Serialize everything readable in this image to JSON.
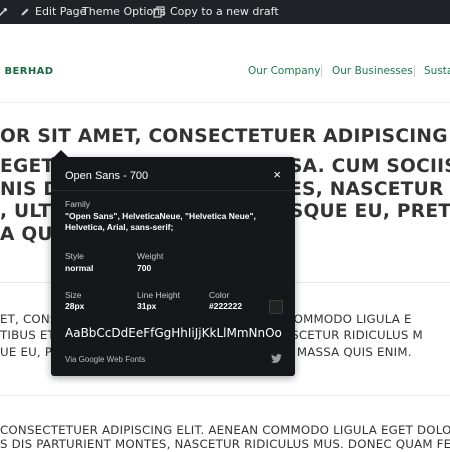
{
  "adminbar": {
    "items": [
      {
        "label": "",
        "icon": "customize-icon"
      },
      {
        "label": "Edit Page",
        "icon": "pencil-icon"
      },
      {
        "label": "Theme Options",
        "icon": ""
      },
      {
        "label": "Copy to a new draft",
        "icon": "copy-icon"
      }
    ]
  },
  "header": {
    "logo": "G BERHAD",
    "nav": [
      "Our Company",
      "Our Businesses",
      "Susta"
    ]
  },
  "content": {
    "large_lines": [
      "OR SIT AMET, CONSECTETUER ADIPISCING ELIT.",
      "EGET DOLOR. AENEAN MASSA. CUM SOCIIS NA",
      "NIS DIS PARTURIENT MONTES, NASCETUR RID",
      ", ULTRICIES NEC, PELLENTESQUE EU, PRETIUM",
      "A QUIS ENIM."
    ],
    "medium_lines": [
      "ET, CONSECTETUER ADIPISCING ELIT. AENEAN COMMODO LIGULA E",
      "TIBUS ET MAGNIS DIS PARTURIENT MONTES, NASCETUR RIDICULUS M",
      "UE EU, PRETIUM QUIS, SEM. NULLA CONSEQUAT MASSA QUIS ENIM."
    ],
    "small_lines": [
      "CONSECTETUER ADIPISCING ELIT. AENEAN COMMODO LIGULA EGET DOLO",
      "S DIS PARTURIENT MONTES, NASCETUR RIDICULUS MUS. DONEC QUAM FEL"
    ]
  },
  "tooltip": {
    "title": "Open Sans - 700",
    "close": "×",
    "family_label": "Family",
    "family_value": "\"Open Sans\", HelveticaNeue, \"Helvetica Neue\", Helvetica, Arial, sans-serif;",
    "style_label": "Style",
    "style_value": "normal",
    "weight_label": "Weight",
    "weight_value": "700",
    "size_label": "Size",
    "size_value": "28px",
    "line_height_label": "Line Height",
    "line_height_value": "31px",
    "color_label": "Color",
    "color_value": "#222222",
    "sample": "AaBbCcDdEeFfGgHhIiJjKkLlMmNnOoPpQ",
    "via": "Via Google Web Fonts",
    "share_icon": "twitter-icon"
  },
  "colors": {
    "adminbar_bg": "#1f2327",
    "brand_green": "#1a6a42",
    "nav_green": "#1e7a4c",
    "tooltip_bg": "#15171a",
    "swatch": "#222222"
  }
}
